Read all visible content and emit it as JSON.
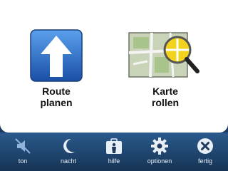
{
  "main": {
    "tiles": [
      {
        "id": "route",
        "line1": "Route",
        "line2": "planen"
      },
      {
        "id": "map",
        "line1": "Karte",
        "line2": "rollen"
      }
    ]
  },
  "toolbar": {
    "buttons": [
      {
        "label": "ton",
        "icon": "sound-off-icon"
      },
      {
        "label": "nacht",
        "icon": "moon-icon"
      },
      {
        "label": "hilfe",
        "icon": "help-kit-icon"
      },
      {
        "label": "optionen",
        "icon": "gear-icon"
      },
      {
        "label": "fertig",
        "icon": "close-icon"
      }
    ]
  },
  "colors": {
    "toolbar": "#1c3a5e",
    "route_icon": "#1f6bc4",
    "map_magnifier": "#f2d21a"
  }
}
